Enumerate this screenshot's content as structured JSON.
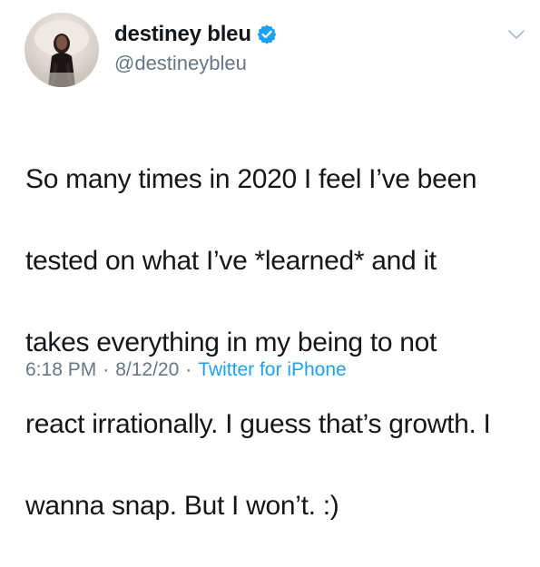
{
  "user": {
    "display_name": "destiney bleu",
    "handle": "@destineybleu",
    "verified": true
  },
  "tweet": {
    "text_lines": [
      "So many times in 2020 I feel I’ve been",
      "tested on what I’ve *learned* and it",
      "takes everything in my being to not",
      "react irrationally. I guess that’s growth. I",
      "wanna snap. But I won’t. :)"
    ],
    "time": "6:18 PM",
    "separator": "·",
    "date": "8/12/20",
    "source": "Twitter for iPhone"
  },
  "icons": {
    "verified": "verified-badge-icon",
    "menu": "chevron-down-icon"
  },
  "colors": {
    "text": "#14171a",
    "secondary": "#657786",
    "accent": "#1da1f2"
  }
}
